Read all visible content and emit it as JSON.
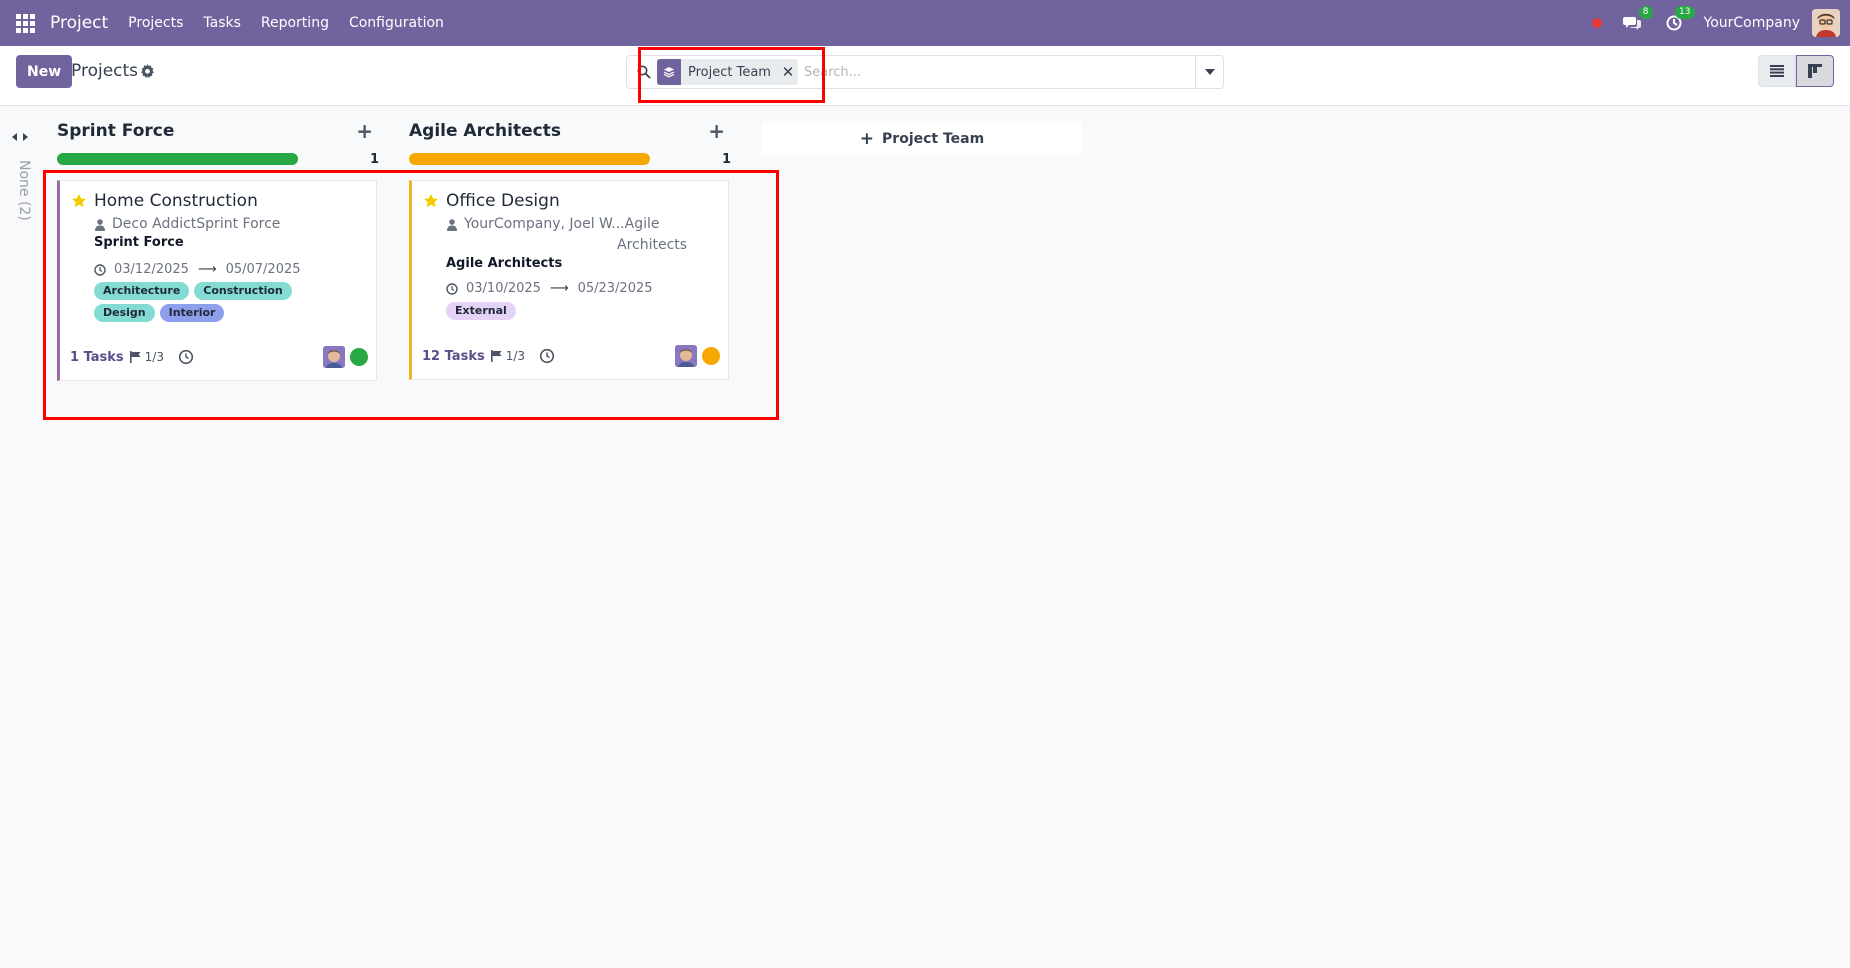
{
  "navbar": {
    "app_name": "Project",
    "menu": [
      "Projects",
      "Tasks",
      "Reporting",
      "Configuration"
    ],
    "messages_badge": "8",
    "activities_badge": "13",
    "company": "YourCompany",
    "color": "#71639e"
  },
  "control_panel": {
    "new_button": "New",
    "breadcrumb": "Projects",
    "search": {
      "facet_label": "Project Team",
      "placeholder": "Search..."
    }
  },
  "kanban": {
    "folded_column": "None (2)",
    "add_column_label": "Project Team",
    "columns": [
      {
        "title": "Sprint Force",
        "count": "1",
        "progress_color": "#28a745",
        "progress_fraction": 1.0,
        "card": {
          "title": "Home Construction",
          "customer": "Deco AddictSprint Force",
          "team": "Sprint Force",
          "date_start": "03/12/2025",
          "date_end": "05/07/2025",
          "tags": [
            "Architecture",
            "Construction",
            "Design",
            "Interior"
          ],
          "tasks": "1 Tasks",
          "milestones": "1/3",
          "status_color": "#28a745"
        }
      },
      {
        "title": "Agile Architects",
        "count": "1",
        "progress_color": "#f7a800",
        "progress_fraction": 1.0,
        "card": {
          "title": "Office Design",
          "customer_line1": "YourCompany, Joel W...Agile",
          "customer_line2": "Architects",
          "team": "Agile Architects",
          "date_start": "03/10/2025",
          "date_end": "05/23/2025",
          "tags": [
            "External"
          ],
          "tasks": "12 Tasks",
          "milestones": "1/3",
          "status_color": "#f7a800"
        }
      }
    ]
  }
}
